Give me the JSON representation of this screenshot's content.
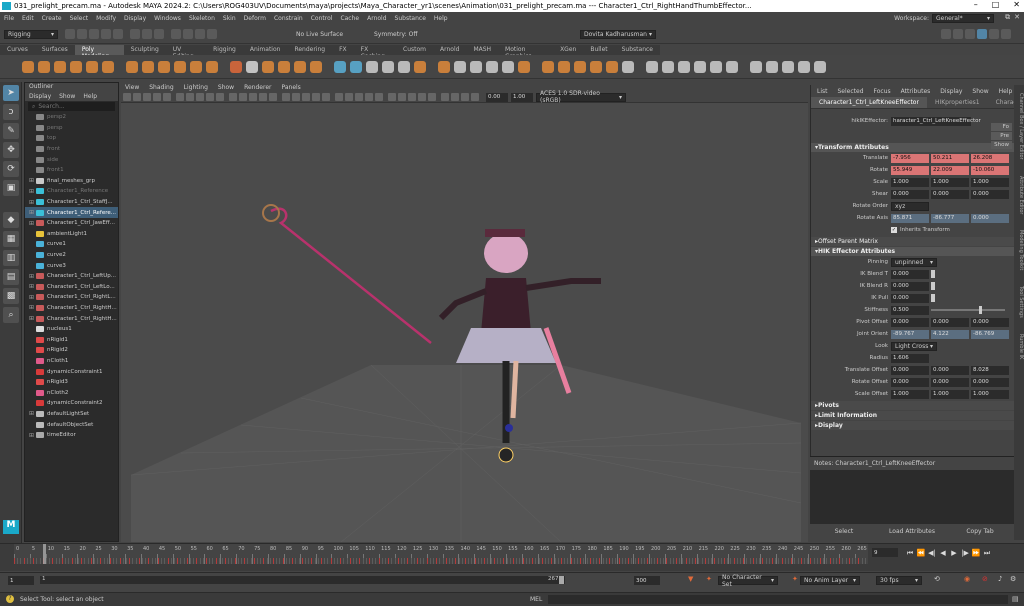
{
  "window": {
    "title": "031_prelight_precam.ma - Autodesk MAYA 2024.2: C:\\Users\\ROG403UV\\Documents\\maya\\projects\\Maya_Character_yr1\\scenes\\Animation\\031_prelight_precam.ma  ---  Character1_Ctrl_RightHandThumbEffector..."
  },
  "menubar": {
    "items": [
      "File",
      "Edit",
      "Create",
      "Select",
      "Modify",
      "Display",
      "Windows",
      "Skeleton",
      "Skin",
      "Deform",
      "Constrain",
      "Control",
      "Cache",
      "Arnold",
      "Substance",
      "Help"
    ]
  },
  "workspace": {
    "label": "Workspace:",
    "value": "General*"
  },
  "statusline": {
    "mode": "Rigging",
    "live_surface": "No Live Surface",
    "symmetry": "Symmetry: Off",
    "user": "Dovita Kadharusman"
  },
  "shelf": {
    "tabs": [
      "Curves",
      "Surfaces",
      "Poly Modeling",
      "Sculpting",
      "UV Editing",
      "Rigging",
      "Animation",
      "Rendering",
      "FX",
      "FX Caching",
      "Custom",
      "Arnold",
      "MASH",
      "Motion Graphics",
      "XGen",
      "Bullet",
      "Substance"
    ],
    "active": "Poly Modeling"
  },
  "outliner": {
    "title": "Outliner",
    "menu": [
      "Display",
      "Show",
      "Help"
    ],
    "search_placeholder": "Search...",
    "items": [
      {
        "label": "persp2",
        "dim": true,
        "type": "cam"
      },
      {
        "label": "persp",
        "dim": true,
        "type": "cam"
      },
      {
        "label": "top",
        "dim": true,
        "type": "cam"
      },
      {
        "label": "front",
        "dim": true,
        "type": "cam"
      },
      {
        "label": "side",
        "dim": true,
        "type": "cam"
      },
      {
        "label": "front1",
        "dim": true,
        "type": "cam"
      },
      {
        "label": "final_meshes_grp",
        "type": "grp",
        "exp": true
      },
      {
        "label": "Character1_Reference",
        "dim": true,
        "type": "joint",
        "exp": true
      },
      {
        "label": "Character1_Ctrl_StaffJ...",
        "type": "joint",
        "exp": true
      },
      {
        "label": "Character1_Ctrl_Refere...",
        "type": "joint",
        "exp": true,
        "hl": true
      },
      {
        "label": "Character1_Ctrl_JawEff...",
        "type": "ctrl",
        "exp": true
      },
      {
        "label": "ambientLight1",
        "type": "light"
      },
      {
        "label": "curve1",
        "type": "curve"
      },
      {
        "label": "curve2",
        "type": "curve"
      },
      {
        "label": "curve3",
        "type": "curve"
      },
      {
        "label": "Character1_Ctrl_LeftUp...",
        "type": "ctrl",
        "exp": true
      },
      {
        "label": "Character1_Ctrl_LeftLo...",
        "type": "ctrl",
        "exp": true
      },
      {
        "label": "Character1_Ctrl_RightL...",
        "type": "ctrl",
        "exp": true
      },
      {
        "label": "Character1_Ctrl_RightH...",
        "type": "ctrl",
        "exp": true
      },
      {
        "label": "Character1_Ctrl_RightH...",
        "type": "ctrl",
        "exp": true
      },
      {
        "label": "nucleus1",
        "type": "node"
      },
      {
        "label": "nRigid1",
        "type": "rigid"
      },
      {
        "label": "nRigid2",
        "type": "rigid"
      },
      {
        "label": "nCloth1",
        "type": "cloth"
      },
      {
        "label": "dynamicConstraint1",
        "type": "constraint"
      },
      {
        "label": "nRigid3",
        "type": "rigid"
      },
      {
        "label": "nCloth2",
        "type": "cloth"
      },
      {
        "label": "dynamicConstraint2",
        "type": "constraint"
      },
      {
        "label": "defaultLightSet",
        "type": "set",
        "exp": true
      },
      {
        "label": "defaultObjectSet",
        "type": "set"
      },
      {
        "label": "timeEditor",
        "type": "editor",
        "exp": true
      }
    ]
  },
  "viewport": {
    "menu": [
      "View",
      "Shading",
      "Lighting",
      "Show",
      "Renderer",
      "Panels"
    ],
    "exposure": "0.00",
    "gamma": "1.00",
    "colorspace": "ACES 1.0 SDR-video (sRGB)"
  },
  "attr_editor": {
    "menu": [
      "List",
      "Selected",
      "Focus",
      "Attributes",
      "Display",
      "Show",
      "Help"
    ],
    "tabs": [
      "Character1_Ctrl_LeftKneeEffector",
      "HIKproperties1",
      "Character1"
    ],
    "node_label": "hikIKEffector:",
    "node_value": "haracter1_Ctrl_LeftKneeEffector",
    "side_buttons": [
      "Fo",
      "Pre",
      "Show"
    ],
    "transform_title": "Transform Attributes",
    "transform": [
      {
        "label": "Translate",
        "values": [
          "-7.956",
          "50.211",
          "26.208"
        ],
        "state": "key"
      },
      {
        "label": "Rotate",
        "values": [
          "55.949",
          "22.009",
          "-10.060"
        ],
        "state": "key"
      },
      {
        "label": "Scale",
        "values": [
          "1.000",
          "1.000",
          "1.000"
        ]
      },
      {
        "label": "Shear",
        "values": [
          "0.000",
          "0.000",
          "0.000"
        ]
      }
    ],
    "rotate_order": {
      "label": "Rotate Order",
      "value": "xyz"
    },
    "rotate_axis": {
      "label": "Rotate Axis",
      "values": [
        "85.871",
        "-86.777",
        "0.000"
      ]
    },
    "inherits": "Inherits Transform",
    "offset_parent": "Offset Parent Matrix",
    "hik_title": "HIK Effector Attributes",
    "pinning": {
      "label": "Pinning",
      "value": "unpinned"
    },
    "blends": [
      {
        "label": "IK Blend T",
        "value": "0.000"
      },
      {
        "label": "IK Blend R",
        "value": "0.000"
      },
      {
        "label": "IK Pull",
        "value": "0.000"
      }
    ],
    "stiffness": {
      "label": "Stiffness",
      "value": "0.500"
    },
    "pivot_offset": {
      "label": "Pivot Offset",
      "values": [
        "0.000",
        "0.000",
        "0.000"
      ]
    },
    "joint_orient": {
      "label": "Joint Orient",
      "values": [
        "-89.767",
        "4.122",
        "-86.769"
      ]
    },
    "look": {
      "label": "Look",
      "value": "Light Cross"
    },
    "radius": {
      "label": "Radius",
      "value": "1.606"
    },
    "offsets": [
      {
        "label": "Translate Offset",
        "values": [
          "0.000",
          "0.000",
          "8.028"
        ]
      },
      {
        "label": "Rotate Offset",
        "values": [
          "0.000",
          "0.000",
          "0.000"
        ]
      },
      {
        "label": "Scale Offset",
        "values": [
          "1.000",
          "1.000",
          "1.000"
        ]
      }
    ],
    "collapsed": [
      "Pivots",
      "Limit Information",
      "Display"
    ],
    "notes": "Notes: Character1_Ctrl_LeftKneeEffector",
    "buttons": [
      "Select",
      "Load Attributes",
      "Copy Tab"
    ],
    "side_tabs": [
      "Channel Box / Layer Editor",
      "Attribute Editor",
      "Modeling Toolkit",
      "Tool Settings",
      "Rumble IK"
    ]
  },
  "timeline": {
    "ticks": [
      "0",
      "5",
      "10",
      "15",
      "20",
      "25",
      "30",
      "35",
      "40",
      "45",
      "50",
      "55",
      "60",
      "65",
      "70",
      "75",
      "80",
      "85",
      "90",
      "95",
      "100",
      "105",
      "110",
      "115",
      "120",
      "125",
      "130",
      "135",
      "140",
      "145",
      "150",
      "155",
      "160",
      "165",
      "170",
      "175",
      "180",
      "185",
      "190",
      "195",
      "200",
      "205",
      "210",
      "215",
      "220",
      "225",
      "230",
      "235",
      "240",
      "245",
      "250",
      "255",
      "260",
      "265"
    ],
    "current_frame": "9",
    "range_start": "1",
    "range_start2": "1",
    "range_end": "267",
    "anim_end": "300",
    "char_set": "No Character Set",
    "anim_layer": "No Anim Layer",
    "fps": "30 fps"
  },
  "cmdline": {
    "mode": "MEL",
    "help": "Select Tool: select an object"
  },
  "colors": {
    "keyed": "#db7575",
    "connected": "#5b6e80",
    "highlight": "#3e5e78",
    "accent": "#5285a6"
  }
}
